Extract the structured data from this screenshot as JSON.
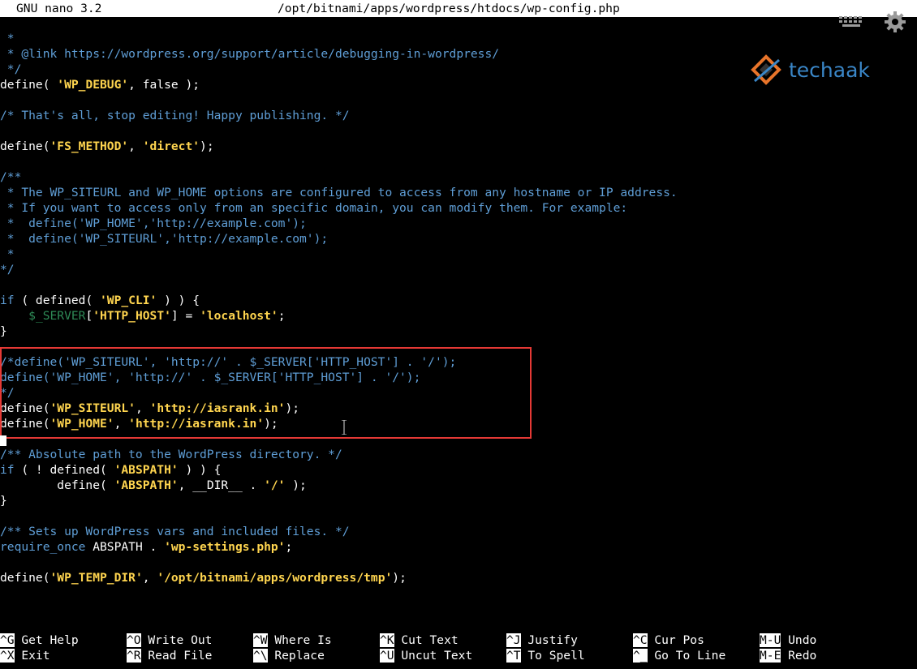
{
  "titlebar": {
    "app": "GNU nano 3.2",
    "file_path": "/opt/bitnami/apps/wordpress/htdocs/wp-config.php"
  },
  "logo": {
    "text": "techaak"
  },
  "code_lines": [
    [
      {
        "t": " *",
        "c": "c"
      }
    ],
    [
      {
        "t": " * @link https://wordpress.org/support/article/debugging-in-wordpress/",
        "c": "c"
      }
    ],
    [
      {
        "t": " */",
        "c": "c"
      }
    ],
    [
      {
        "t": "define( ",
        "c": "p"
      },
      {
        "t": "'WP_DEBUG'",
        "c": "s"
      },
      {
        "t": ", false );",
        "c": "p"
      }
    ],
    [],
    [
      {
        "t": "/* That's all, stop editing! Happy publishing. */",
        "c": "c"
      }
    ],
    [],
    [
      {
        "t": "define(",
        "c": "p"
      },
      {
        "t": "'FS_METHOD'",
        "c": "s"
      },
      {
        "t": ", ",
        "c": "p"
      },
      {
        "t": "'direct'",
        "c": "s"
      },
      {
        "t": ");",
        "c": "p"
      }
    ],
    [],
    [
      {
        "t": "/**",
        "c": "c"
      }
    ],
    [
      {
        "t": " * The WP_SITEURL and WP_HOME options are configured to access from any hostname or IP address.",
        "c": "c"
      }
    ],
    [
      {
        "t": " * If you want to access only from an specific domain, you can modify them. For example:",
        "c": "c"
      }
    ],
    [
      {
        "t": " *  define('WP_HOME','http://example.com');",
        "c": "c"
      }
    ],
    [
      {
        "t": " *  define('WP_SITEURL','http://example.com');",
        "c": "c"
      }
    ],
    [
      {
        "t": " *",
        "c": "c"
      }
    ],
    [
      {
        "t": "*/",
        "c": "c"
      }
    ],
    [],
    [
      {
        "t": "if",
        "c": "k"
      },
      {
        "t": " ( defined( ",
        "c": "p"
      },
      {
        "t": "'WP_CLI'",
        "c": "s"
      },
      {
        "t": " ) ) {",
        "c": "p"
      }
    ],
    [
      {
        "t": "    ",
        "c": "p"
      },
      {
        "t": "$_SERVER",
        "c": "v"
      },
      {
        "t": "[",
        "c": "p"
      },
      {
        "t": "'HTTP_HOST'",
        "c": "s"
      },
      {
        "t": "] = ",
        "c": "p"
      },
      {
        "t": "'localhost'",
        "c": "s"
      },
      {
        "t": ";",
        "c": "p"
      }
    ],
    [
      {
        "t": "}",
        "c": "p"
      }
    ],
    [],
    [
      {
        "t": "/*define('WP_SITEURL', 'http://' . $_SERVER['HTTP_HOST'] . '/');",
        "c": "c"
      }
    ],
    [
      {
        "t": "define('WP_HOME', 'http://' . $_SERVER['HTTP_HOST'] . '/');",
        "c": "c"
      }
    ],
    [
      {
        "t": "*/",
        "c": "c"
      }
    ],
    [
      {
        "t": "define(",
        "c": "p"
      },
      {
        "t": "'WP_SITEURL'",
        "c": "s"
      },
      {
        "t": ", ",
        "c": "p"
      },
      {
        "t": "'http://iasrank.in'",
        "c": "s"
      },
      {
        "t": ");",
        "c": "p"
      }
    ],
    [
      {
        "t": "define(",
        "c": "p"
      },
      {
        "t": "'WP_HOME'",
        "c": "s"
      },
      {
        "t": ", ",
        "c": "p"
      },
      {
        "t": "'http://iasrank.in'",
        "c": "s"
      },
      {
        "t": ");",
        "c": "p"
      }
    ],
    [],
    [
      {
        "t": "/** Absolute path to the WordPress directory. */",
        "c": "c"
      }
    ],
    [
      {
        "t": "if",
        "c": "k"
      },
      {
        "t": " ( ! defined( ",
        "c": "p"
      },
      {
        "t": "'ABSPATH'",
        "c": "s"
      },
      {
        "t": " ) ) {",
        "c": "p"
      }
    ],
    [
      {
        "t": "        define( ",
        "c": "p"
      },
      {
        "t": "'ABSPATH'",
        "c": "s"
      },
      {
        "t": ", __DIR__ . ",
        "c": "p"
      },
      {
        "t": "'/'",
        "c": "s"
      },
      {
        "t": " );",
        "c": "p"
      }
    ],
    [
      {
        "t": "}",
        "c": "p"
      }
    ],
    [],
    [
      {
        "t": "/** Sets up WordPress vars and included files. */",
        "c": "c"
      }
    ],
    [
      {
        "t": "require_once",
        "c": "k"
      },
      {
        "t": " ABSPATH . ",
        "c": "p"
      },
      {
        "t": "'wp-settings.php'",
        "c": "s"
      },
      {
        "t": ";",
        "c": "p"
      }
    ],
    [],
    [
      {
        "t": "define(",
        "c": "p"
      },
      {
        "t": "'WP_TEMP_DIR'",
        "c": "s"
      },
      {
        "t": ", ",
        "c": "p"
      },
      {
        "t": "'/opt/bitnami/apps/wordpress/tmp'",
        "c": "s"
      },
      {
        "t": ");",
        "c": "p"
      }
    ]
  ],
  "colors": {
    "comment": "#5f9ed6",
    "string": "#ffd54f",
    "variable": "#2e8b57",
    "highlight_box": "#e53935",
    "logo": "#3a86c7"
  },
  "shortcuts": [
    [
      {
        "key": "^G",
        "label": "Get Help"
      },
      {
        "key": "^O",
        "label": "Write Out"
      },
      {
        "key": "^W",
        "label": "Where Is"
      },
      {
        "key": "^K",
        "label": "Cut Text"
      },
      {
        "key": "^J",
        "label": "Justify"
      },
      {
        "key": "^C",
        "label": "Cur Pos"
      },
      {
        "key": "M-U",
        "label": "Undo"
      }
    ],
    [
      {
        "key": "^X",
        "label": "Exit"
      },
      {
        "key": "^R",
        "label": "Read File"
      },
      {
        "key": "^\\",
        "label": "Replace"
      },
      {
        "key": "^U",
        "label": "Uncut Text"
      },
      {
        "key": "^T",
        "label": "To Spell"
      },
      {
        "key": "^_",
        "label": "Go To Line"
      },
      {
        "key": "M-E",
        "label": "Redo"
      }
    ]
  ]
}
